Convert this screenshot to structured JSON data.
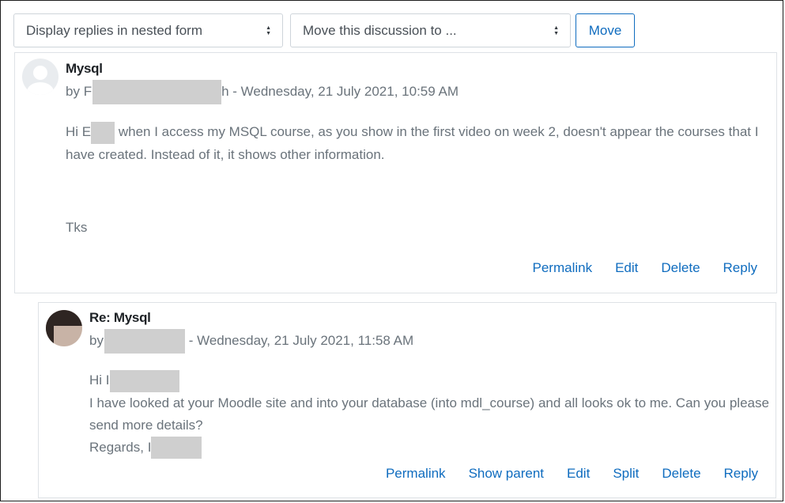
{
  "controls": {
    "display_mode": "Display replies in nested form",
    "move_discussion": "Move this discussion to ...",
    "move_button": "Move"
  },
  "posts": [
    {
      "subject": "Mysql",
      "by_prefix": "by ",
      "by_partial_start": "F",
      "by_partial_end": "h",
      "date": " - Wednesday, 21 July 2021, 10:59 AM",
      "body": {
        "hi": "Hi ",
        "hi_partial": "E",
        "line1_rest": "when I access my MSQL course, as you show in the first video on week 2, doesn't appear the courses that I have created. Instead of it, it shows other information.",
        "thanks": "Tks"
      },
      "actions": [
        "Permalink",
        "Edit",
        "Delete",
        "Reply"
      ]
    },
    {
      "subject": "Re: Mysql",
      "by_prefix": "by",
      "date": " - Wednesday, 21 July 2021, 11:58 AM",
      "body": {
        "hi": "Hi ",
        "hi_partial": "I",
        "line1": "I have looked at your Moodle site and into your database (into mdl_course) and all looks ok to me. Can you please send more details?",
        "regards": "Regards, ",
        "regards_partial": "I"
      },
      "actions": [
        "Permalink",
        "Show parent",
        "Edit",
        "Split",
        "Delete",
        "Reply"
      ]
    }
  ],
  "colors": {
    "link": "#0f6cbf",
    "muted_text": "#6a737b",
    "border": "#dee2e6",
    "redaction": "#cfcfcf"
  }
}
